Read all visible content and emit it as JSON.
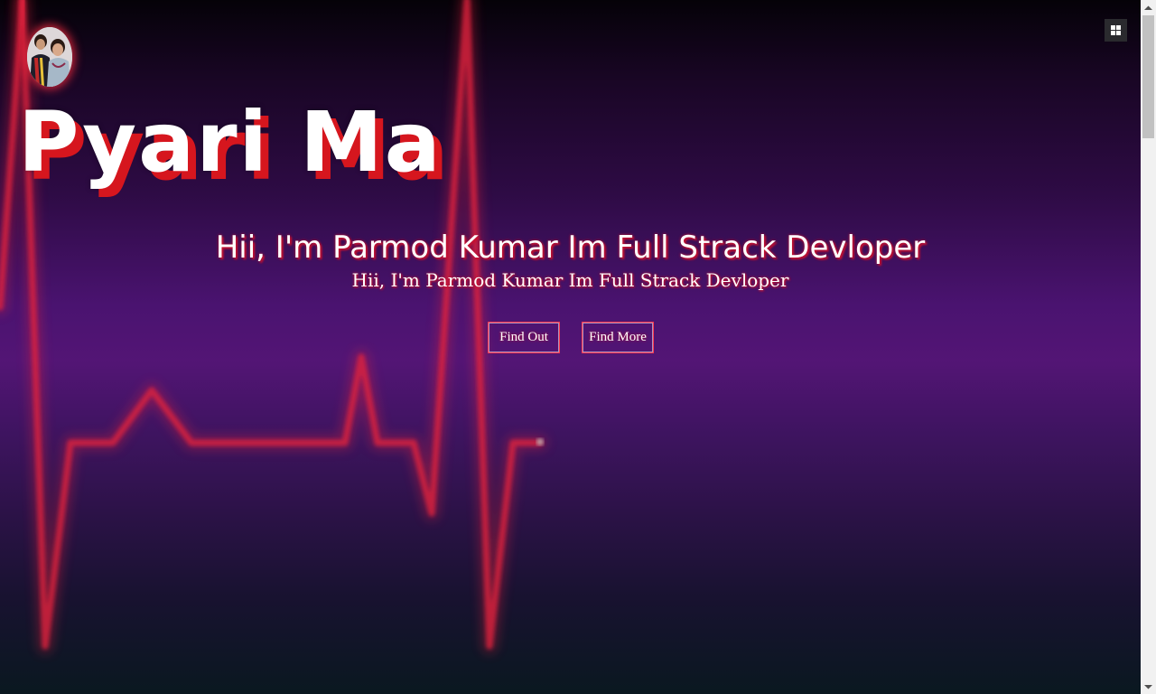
{
  "hero": {
    "title": "Pyari Ma",
    "headline": "Hii, I'm Parmod Kumar Im Full Strack Devloper",
    "subline": "Hii, I'm Parmod Kumar Im Full Strack Devloper"
  },
  "buttons": {
    "find_out": "Find Out",
    "find_more": "Find More"
  },
  "icons": {
    "menu": "grid-menu-icon",
    "avatar": "profile-photo",
    "background": "heartbeat-pulse-line"
  },
  "colors": {
    "accent": "#d6161e",
    "pulse": "#e01e3c",
    "background_mid": "#531575"
  }
}
